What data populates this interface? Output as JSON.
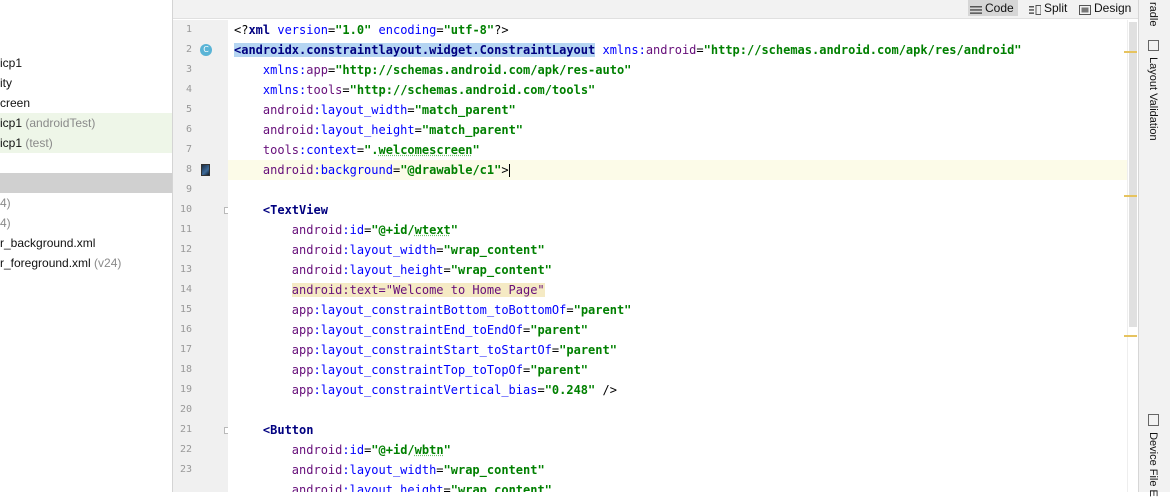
{
  "project_tree": [
    {
      "text": "icp1",
      "suffix": "",
      "style": "normal"
    },
    {
      "text": "ity",
      "suffix": "",
      "style": "normal"
    },
    {
      "text": "creen",
      "suffix": "",
      "style": "normal"
    },
    {
      "text": "icp1",
      "suffix": " (androidTest)",
      "style": "green"
    },
    {
      "text": "icp1",
      "suffix": " (test)",
      "style": "green"
    },
    {
      "text": "",
      "suffix": "",
      "style": "normal"
    },
    {
      "text": "",
      "suffix": "",
      "style": "selected"
    },
    {
      "text": "4)",
      "suffix": "",
      "style": "muted"
    },
    {
      "text": "4)",
      "suffix": "",
      "style": "muted"
    },
    {
      "text": "r_background.xml",
      "suffix": "",
      "style": "normal"
    },
    {
      "text": "r_foreground.xml",
      "suffix": " (v24)",
      "style": "normal"
    }
  ],
  "view_modes": {
    "code": "Code",
    "split": "Split",
    "design": "Design"
  },
  "right_panel": {
    "gradle": "radle",
    "layout_validation": "Layout Validation",
    "device_file": "Device File E"
  },
  "line_numbers": [
    "1",
    "2",
    "3",
    "4",
    "5",
    "6",
    "7",
    "8",
    "9",
    "10",
    "11",
    "12",
    "13",
    "14",
    "15",
    "16",
    "17",
    "18",
    "19",
    "20",
    "21",
    "22",
    "23"
  ],
  "gutter_marker": "C",
  "colors": {
    "tag": "#000080",
    "attribute": "#660e7a",
    "namespace": "#0000ff",
    "value": "#008000"
  },
  "code_lines": [
    [
      {
        "t": "<?",
        "c": "pun"
      },
      {
        "t": "xml ",
        "c": "tag"
      },
      {
        "t": "version",
        "c": "ns"
      },
      {
        "t": "=",
        "c": "pun"
      },
      {
        "t": "\"1.0\"",
        "c": "val"
      },
      {
        "t": " ",
        "c": "pun"
      },
      {
        "t": "encoding",
        "c": "ns"
      },
      {
        "t": "=",
        "c": "pun"
      },
      {
        "t": "\"utf-8\"",
        "c": "val"
      },
      {
        "t": "?>",
        "c": "pun"
      }
    ],
    [
      {
        "t": "<androidx.constraintlayout.widget.ConstraintLayout",
        "c": "tag",
        "hl": true
      },
      {
        "t": " ",
        "c": "pun"
      },
      {
        "t": "xmlns:",
        "c": "ns"
      },
      {
        "t": "android",
        "c": "attr"
      },
      {
        "t": "=",
        "c": "pun"
      },
      {
        "t": "\"http://schemas.android.com/apk/res/android\"",
        "c": "val"
      }
    ],
    [
      {
        "t": "    ",
        "c": "pun"
      },
      {
        "t": "xmlns:",
        "c": "ns"
      },
      {
        "t": "app",
        "c": "attr"
      },
      {
        "t": "=",
        "c": "pun"
      },
      {
        "t": "\"http://schemas.android.com/apk/res-auto\"",
        "c": "val"
      }
    ],
    [
      {
        "t": "    ",
        "c": "pun"
      },
      {
        "t": "xmlns:",
        "c": "ns"
      },
      {
        "t": "tools",
        "c": "attr"
      },
      {
        "t": "=",
        "c": "pun"
      },
      {
        "t": "\"http://schemas.android.com/tools\"",
        "c": "val"
      }
    ],
    [
      {
        "t": "    ",
        "c": "pun"
      },
      {
        "t": "android",
        "c": "attr"
      },
      {
        "t": ":layout_width",
        "c": "ns"
      },
      {
        "t": "=",
        "c": "pun"
      },
      {
        "t": "\"match_parent\"",
        "c": "val"
      }
    ],
    [
      {
        "t": "    ",
        "c": "pun"
      },
      {
        "t": "android",
        "c": "attr"
      },
      {
        "t": ":layout_height",
        "c": "ns"
      },
      {
        "t": "=",
        "c": "pun"
      },
      {
        "t": "\"match_parent\"",
        "c": "val"
      }
    ],
    [
      {
        "t": "    ",
        "c": "pun"
      },
      {
        "t": "tools",
        "c": "attr"
      },
      {
        "t": ":context",
        "c": "ns"
      },
      {
        "t": "=",
        "c": "pun"
      },
      {
        "t": "\".",
        "c": "val"
      },
      {
        "t": "welcomescreen",
        "c": "val",
        "u": true
      },
      {
        "t": "\"",
        "c": "val"
      }
    ],
    [
      {
        "t": "    ",
        "c": "pun"
      },
      {
        "t": "android",
        "c": "attr"
      },
      {
        "t": ":background",
        "c": "ns"
      },
      {
        "t": "=",
        "c": "pun"
      },
      {
        "t": "\"@drawable/c1\"",
        "c": "val"
      },
      {
        "t": ">",
        "c": "pun"
      }
    ],
    [],
    [
      {
        "t": "    ",
        "c": "pun"
      },
      {
        "t": "<TextView",
        "c": "tag"
      }
    ],
    [
      {
        "t": "        ",
        "c": "pun"
      },
      {
        "t": "android",
        "c": "attr"
      },
      {
        "t": ":id",
        "c": "ns"
      },
      {
        "t": "=",
        "c": "pun"
      },
      {
        "t": "\"@+id/",
        "c": "val"
      },
      {
        "t": "wtext",
        "c": "val",
        "u": true
      },
      {
        "t": "\"",
        "c": "val"
      }
    ],
    [
      {
        "t": "        ",
        "c": "pun"
      },
      {
        "t": "android",
        "c": "attr"
      },
      {
        "t": ":layout_width",
        "c": "ns"
      },
      {
        "t": "=",
        "c": "pun"
      },
      {
        "t": "\"wrap_content\"",
        "c": "val"
      }
    ],
    [
      {
        "t": "        ",
        "c": "pun"
      },
      {
        "t": "android",
        "c": "attr"
      },
      {
        "t": ":layout_height",
        "c": "ns"
      },
      {
        "t": "=",
        "c": "pun"
      },
      {
        "t": "\"wrap_content\"",
        "c": "val"
      }
    ],
    [
      {
        "t": "        ",
        "c": "pun"
      },
      {
        "t": "android:text=\"Welcome to Home Page\"",
        "c": "attr",
        "hl2": true
      }
    ],
    [
      {
        "t": "        ",
        "c": "pun"
      },
      {
        "t": "app",
        "c": "attr"
      },
      {
        "t": ":layout_constraintBottom_toBottomOf",
        "c": "ns"
      },
      {
        "t": "=",
        "c": "pun"
      },
      {
        "t": "\"parent\"",
        "c": "val"
      }
    ],
    [
      {
        "t": "        ",
        "c": "pun"
      },
      {
        "t": "app",
        "c": "attr"
      },
      {
        "t": ":layout_constraintEnd_toEndOf",
        "c": "ns"
      },
      {
        "t": "=",
        "c": "pun"
      },
      {
        "t": "\"parent\"",
        "c": "val"
      }
    ],
    [
      {
        "t": "        ",
        "c": "pun"
      },
      {
        "t": "app",
        "c": "attr"
      },
      {
        "t": ":layout_constraintStart_toStartOf",
        "c": "ns"
      },
      {
        "t": "=",
        "c": "pun"
      },
      {
        "t": "\"parent\"",
        "c": "val"
      }
    ],
    [
      {
        "t": "        ",
        "c": "pun"
      },
      {
        "t": "app",
        "c": "attr"
      },
      {
        "t": ":layout_constraintTop_toTopOf",
        "c": "ns"
      },
      {
        "t": "=",
        "c": "pun"
      },
      {
        "t": "\"parent\"",
        "c": "val"
      }
    ],
    [
      {
        "t": "        ",
        "c": "pun"
      },
      {
        "t": "app",
        "c": "attr"
      },
      {
        "t": ":layout_constraintVertical_bias",
        "c": "ns"
      },
      {
        "t": "=",
        "c": "pun"
      },
      {
        "t": "\"0.248\"",
        "c": "val"
      },
      {
        "t": " />",
        "c": "pun"
      }
    ],
    [],
    [
      {
        "t": "    ",
        "c": "pun"
      },
      {
        "t": "<Button",
        "c": "tag"
      }
    ],
    [
      {
        "t": "        ",
        "c": "pun"
      },
      {
        "t": "android",
        "c": "attr"
      },
      {
        "t": ":id",
        "c": "ns"
      },
      {
        "t": "=",
        "c": "pun"
      },
      {
        "t": "\"@+id/",
        "c": "val"
      },
      {
        "t": "wbtn",
        "c": "val",
        "u": true
      },
      {
        "t": "\"",
        "c": "val"
      }
    ],
    [
      {
        "t": "        ",
        "c": "pun"
      },
      {
        "t": "android",
        "c": "attr"
      },
      {
        "t": ":layout_width",
        "c": "ns"
      },
      {
        "t": "=",
        "c": "pun"
      },
      {
        "t": "\"wrap_content\"",
        "c": "val"
      }
    ],
    [
      {
        "t": "        ",
        "c": "pun"
      },
      {
        "t": "android",
        "c": "attr"
      },
      {
        "t": ":layout_height",
        "c": "ns"
      },
      {
        "t": "=",
        "c": "pun"
      },
      {
        "t": "\"wrap_content\"",
        "c": "val"
      }
    ]
  ]
}
